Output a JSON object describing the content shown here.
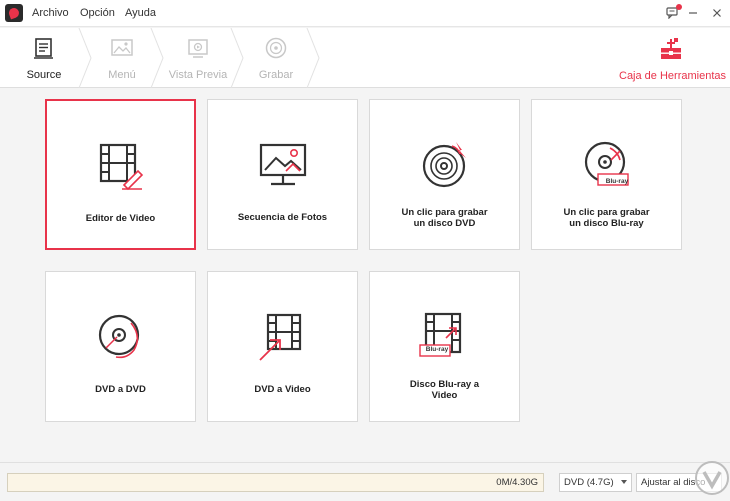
{
  "menu": {
    "archivo": "Archivo",
    "opcion": "Opción",
    "ayuda": "Ayuda"
  },
  "steps": [
    {
      "label": "Source",
      "state": "active",
      "icon": "source-icon"
    },
    {
      "label": "Menú",
      "state": "inactive",
      "icon": "menu-image-icon"
    },
    {
      "label": "Vista Previa",
      "state": "inactive",
      "icon": "preview-icon"
    },
    {
      "label": "Grabar",
      "state": "inactive",
      "icon": "burn-disc-icon"
    }
  ],
  "toolbox": {
    "label": "Caja de Herramientas",
    "icon": "toolbox-icon"
  },
  "cards": [
    {
      "label": "Editor de Video",
      "icon": "film-edit-icon",
      "selected": true
    },
    {
      "label": "Secuencia de Fotos",
      "icon": "photo-monitor-icon",
      "selected": false
    },
    {
      "label1": "Un clic para grabar",
      "label2": "un disco DVD",
      "icon": "dvd-burn-icon",
      "selected": false
    },
    {
      "label1": "Un clic para grabar",
      "label2": "un disco Blu-ray",
      "icon": "bluray-disc-icon",
      "badge": "Blu-ray",
      "selected": false
    },
    {
      "label": "DVD a DVD",
      "icon": "dvd-copy-icon",
      "selected": false
    },
    {
      "label": "DVD a Video",
      "icon": "dvd-to-video-icon",
      "selected": false
    },
    {
      "label1": "Disco Blu-ray a",
      "label2": "Video",
      "icon": "bluray-to-video-icon",
      "badge": "Blu-ray",
      "selected": false
    }
  ],
  "bottom": {
    "progress_text": "0M/4.30G",
    "progress_fraction": 0,
    "dvd_select": "DVD (4.7G)",
    "fit_button": "Ajustar al disco"
  },
  "colors": {
    "accent": "#e8334a",
    "icon_dark": "#333333"
  }
}
